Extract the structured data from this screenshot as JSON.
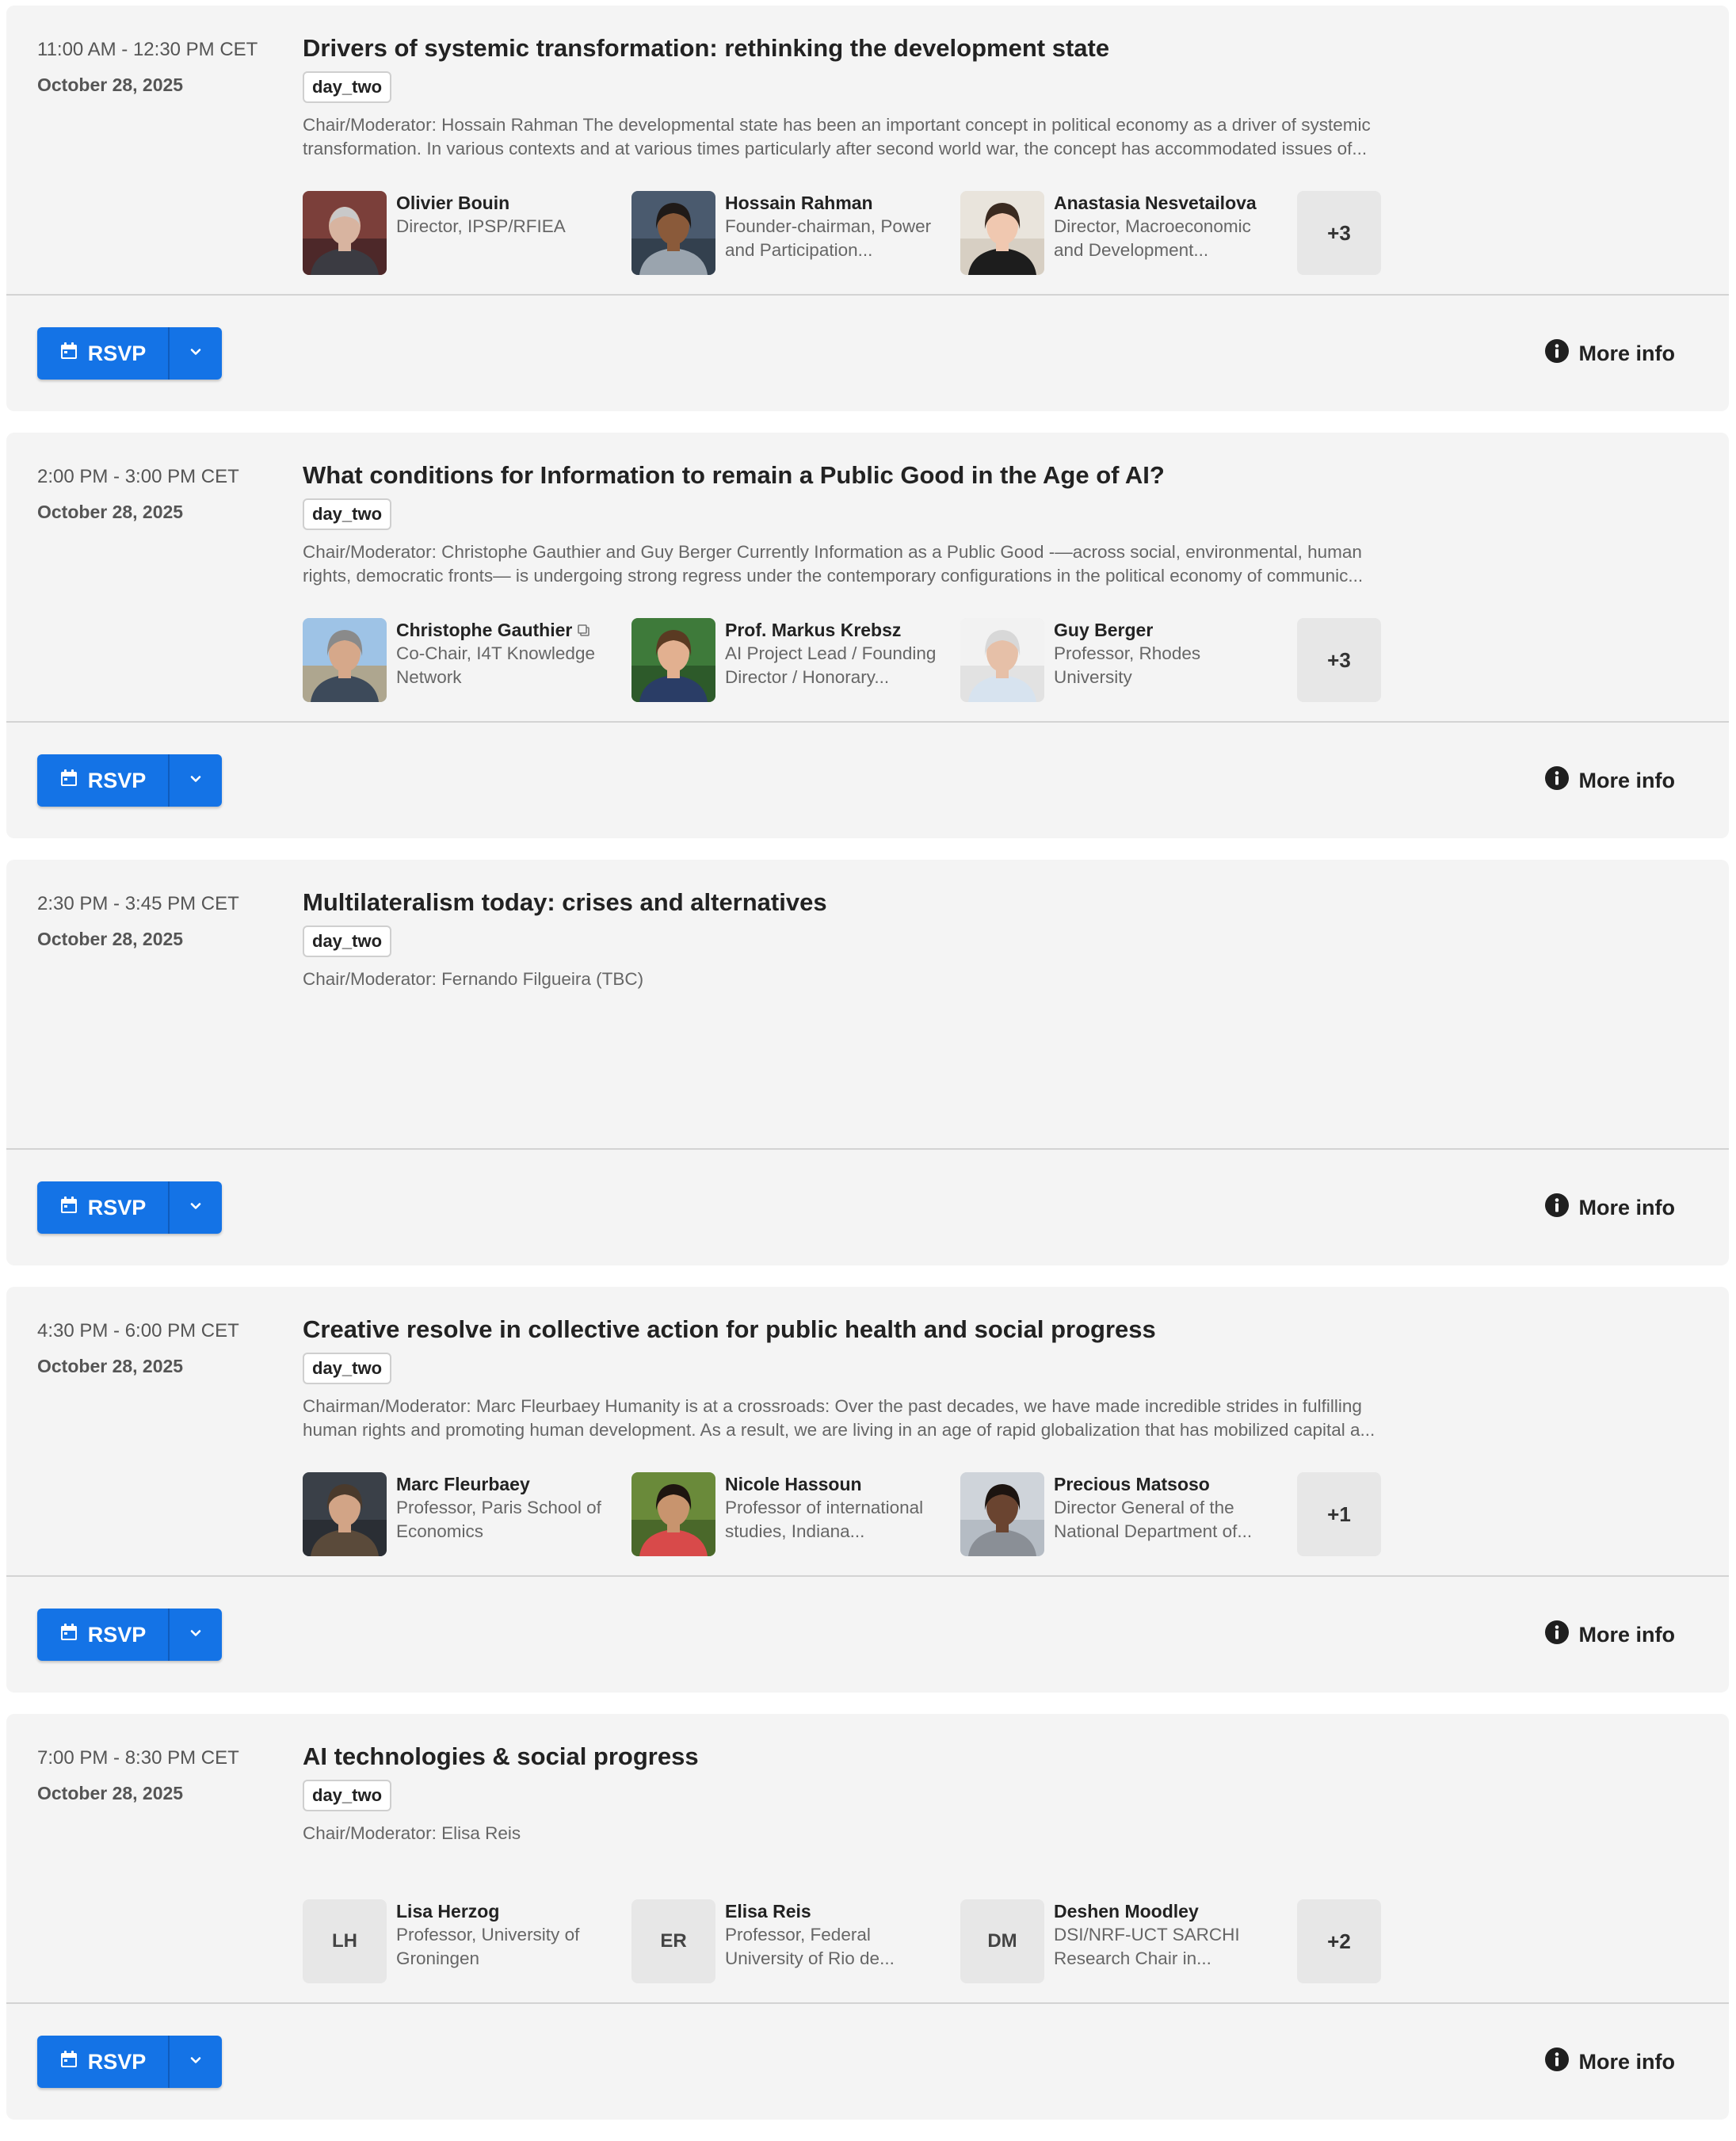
{
  "sessions": [
    {
      "time": "11:00 AM - 12:30 PM CET",
      "date": "October 28, 2025",
      "title": "Drivers of systemic transformation: rethinking the development state",
      "tag": "day_two",
      "description": "Chair/Moderator: Hossain Rahman The developmental state has been an important concept in political economy as a driver of systemic transformation. In various contexts and at various times particularly after second world war, the concept has accommodated issues of...",
      "speakers": [
        {
          "name": "Olivier Bouin",
          "role": "Director, IPSP/RFIEA",
          "photo": "photo-olivier-bouin"
        },
        {
          "name": "Hossain Rahman",
          "role": "Founder-chairman, Power and Participation...",
          "photo": "photo-hossain-rahman"
        },
        {
          "name": "Anastasia Nesvetailova",
          "role": "Director, Macroeconomic and Development...",
          "photo": "photo-anastasia-nesvetailova"
        }
      ],
      "more": "+3",
      "rsvp_label": "RSVP",
      "more_info_label": "More info"
    },
    {
      "time": "2:00 PM - 3:00 PM CET",
      "date": "October 28, 2025",
      "title": "What conditions for Information to remain a Public Good in the Age of AI?",
      "tag": "day_two",
      "description": "Chair/Moderator: Christophe Gauthier and Guy Berger Currently Information as a Public Good -—across social, environmental, human rights, democratic fronts— is undergoing strong regress under the contemporary configurations in the political economy of communic...",
      "speakers": [
        {
          "name": "Christophe Gauthier",
          "role": "Co-Chair, I4T Knowledge Network",
          "photo": "photo-christophe-gauthier",
          "copy_icon": "copy-icon"
        },
        {
          "name": "Prof. Markus Krebsz",
          "role": "AI Project Lead / Founding Director / Honorary...",
          "photo": "photo-markus-krebsz"
        },
        {
          "name": "Guy Berger",
          "role": "Professor, Rhodes University",
          "photo": "photo-guy-berger"
        }
      ],
      "more": "+3",
      "rsvp_label": "RSVP",
      "more_info_label": "More info"
    },
    {
      "time": "2:30 PM - 3:45 PM CET",
      "date": "October 28, 2025",
      "title": "Multilateralism today: crises and alternatives",
      "tag": "day_two",
      "description": "Chair/Moderator: Fernando Filgueira (TBC)",
      "speakers": [],
      "more": "",
      "rsvp_label": "RSVP",
      "more_info_label": "More info"
    },
    {
      "time": "4:30 PM - 6:00 PM CET",
      "date": "October 28, 2025",
      "title": "Creative resolve in collective action for public health and social progress",
      "tag": "day_two",
      "description": "Chairman/Moderator: Marc Fleurbaey Humanity is at a crossroads: Over the past decades, we have made incredible strides in fulfilling human rights and promoting human development. As a result, we are living in an age of rapid globalization that has mobilized capital a...",
      "speakers": [
        {
          "name": "Marc Fleurbaey",
          "role": "Professor, Paris School of Economics",
          "photo": "photo-marc-fleurbaey"
        },
        {
          "name": "Nicole Hassoun",
          "role": "Professor of international studies, Indiana...",
          "photo": "photo-nicole-hassoun"
        },
        {
          "name": "Precious Matsoso",
          "role": "Director General of the National Department of...",
          "photo": "photo-precious-matsoso"
        }
      ],
      "more": "+1",
      "rsvp_label": "RSVP",
      "more_info_label": "More info"
    },
    {
      "time": "7:00 PM - 8:30 PM CET",
      "date": "October 28, 2025",
      "title": "AI technologies & social progress",
      "tag": "day_two",
      "description": "Chair/Moderator: Elisa Reis",
      "speakers": [
        {
          "name": "Lisa Herzog",
          "role": "Professor, University of Groningen",
          "initials": "LH"
        },
        {
          "name": "Elisa Reis",
          "role": "Professor, Federal University of Rio de...",
          "initials": "ER"
        },
        {
          "name": "Deshen Moodley",
          "role": "DSI/NRF-UCT SARCHI Research Chair in...",
          "initials": "DM"
        }
      ],
      "more": "+2",
      "rsvp_label": "RSVP",
      "more_info_label": "More info"
    }
  ],
  "icons": {
    "calendar": "calendar-icon",
    "caret": "chevron-down-icon",
    "info": "info-icon"
  },
  "colors": {
    "accent": "#1473e6",
    "card_background": "#f4f4f4",
    "muted_text": "#666666"
  }
}
